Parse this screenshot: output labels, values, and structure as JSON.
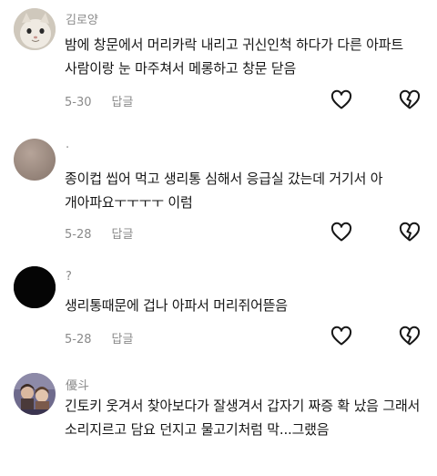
{
  "comments": [
    {
      "username": "김로양",
      "text": "밤에 창문에서 머리카락 내리고 귀신인척 하다가 다른 아파트 사람이랑 눈 마주쳐서 메롱하고 창문 닫음",
      "date": "5-30",
      "reply_label": "답글",
      "avatar_icon": "cat-avatar"
    },
    {
      "username": ".",
      "text": "종이컵 씹어 먹고 생리통 심해서 응급실 갔는데 거기서 아 개아파요ㅜㅜㅜㅜ 이럼",
      "date": "5-28",
      "reply_label": "답글",
      "avatar_icon": "beige-avatar"
    },
    {
      "username": "?",
      "text": "생리통때문에 겁나 아파서 머리쥐어뜯음",
      "date": "5-28",
      "reply_label": "답글",
      "avatar_icon": "black-avatar"
    },
    {
      "username": "優斗",
      "text": "긴토키 웃겨서 찾아보다가 잘생겨서 갑자기 짜증 확 났음 그래서 소리지르고 담요 던지고 물고기처럼 막...그랬음",
      "date": "",
      "reply_label": "",
      "avatar_icon": "anime-avatar"
    }
  ]
}
